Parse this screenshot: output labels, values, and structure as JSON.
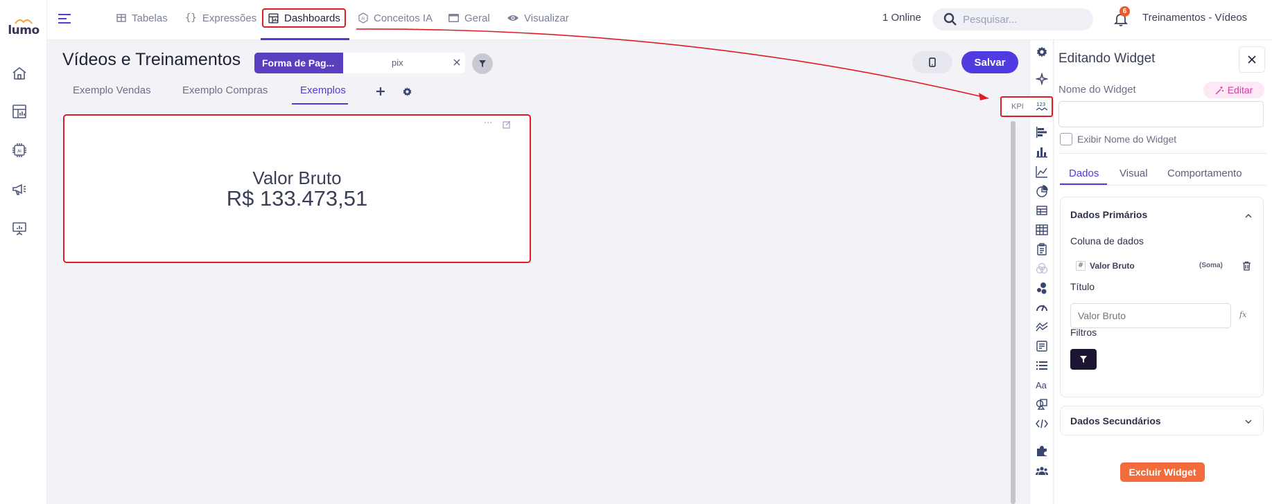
{
  "brand": {
    "logo_text": "lumo",
    "accent": "#4e3bd9",
    "highlight": "#e01b24"
  },
  "sidebar": {
    "items": [
      {
        "icon": "home-icon"
      },
      {
        "icon": "dashboard-icon"
      },
      {
        "icon": "ai-chip-icon"
      },
      {
        "icon": "megaphone-icon"
      },
      {
        "icon": "presentation-icon"
      }
    ]
  },
  "topnav": {
    "items": [
      {
        "label": "Tabelas",
        "icon": "table-icon"
      },
      {
        "label": "Expressões",
        "icon": "braces-icon"
      },
      {
        "label": "Dashboards",
        "icon": "dashboard-icon",
        "active": true
      },
      {
        "label": "Conceitos IA",
        "icon": "ai-icon"
      },
      {
        "label": "Geral",
        "icon": "window-icon"
      },
      {
        "label": "Visualizar",
        "icon": "eye-icon"
      }
    ],
    "online": "1 Online",
    "search_placeholder": "Pesquisar...",
    "notifications": "6",
    "workspace": "Treinamentos - Vídeos"
  },
  "dashboard": {
    "title": "Vídeos e Treinamentos",
    "filter_label": "Forma de Pag...",
    "filter_value": "pix",
    "save_label": "Salvar",
    "tabs": [
      {
        "label": "Exemplo Vendas"
      },
      {
        "label": "Exemplo Compras"
      },
      {
        "label": "Exemplos",
        "active": true
      }
    ]
  },
  "widget": {
    "more": "···",
    "title": "Valor Bruto",
    "value": "R$ 133.473,51"
  },
  "widget_types": {
    "kpi_label": "KPI"
  },
  "panel": {
    "title": "Editando Widget",
    "name_label": "Nome do Widget",
    "editar_label": "Editar",
    "name_value": "",
    "show_name_label": "Exibir Nome do Widget",
    "tabs": [
      {
        "label": "Dados",
        "active": true
      },
      {
        "label": "Visual"
      },
      {
        "label": "Comportamento"
      }
    ],
    "primary": {
      "title": "Dados Primários",
      "column_label": "Coluna de dados",
      "column_hash": "#",
      "column_name": "Valor Bruto",
      "column_agg": "(Soma)",
      "title_label": "Título",
      "title_placeholder": "Valor Bruto",
      "fx": "fx",
      "filters_label": "Filtros"
    },
    "secondary": {
      "title": "Dados Secundários"
    },
    "delete_label": "Excluir Widget"
  }
}
